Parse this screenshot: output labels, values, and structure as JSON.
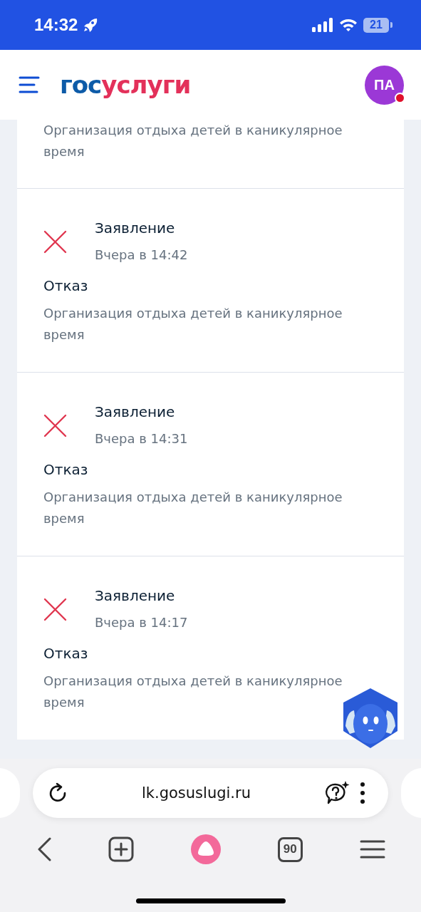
{
  "status_bar": {
    "time": "14:32",
    "battery": "21"
  },
  "header": {
    "logo": [
      "гос",
      "услуги"
    ],
    "avatar": {
      "initials": "ПА",
      "notification": true
    }
  },
  "events": [
    {
      "description": "Организация отдыха детей в каникулярное время"
    },
    {
      "kind": "rejected",
      "title": "Заявление",
      "time": "Вчера в 14:42",
      "status": "Отказ",
      "description": "Организация отдыха детей в каникулярное время"
    },
    {
      "kind": "rejected",
      "title": "Заявление",
      "time": "Вчера в 14:31",
      "status": "Отказ",
      "description": "Организация отдыха детей в каникулярное время"
    },
    {
      "kind": "rejected",
      "title": "Заявление",
      "time": "Вчера в 14:17",
      "status": "Отказ",
      "description": "Организация отдыха детей в каникулярное время"
    }
  ],
  "browser": {
    "url": "lk.gosuslugi.ru",
    "tabs_count": "90"
  }
}
